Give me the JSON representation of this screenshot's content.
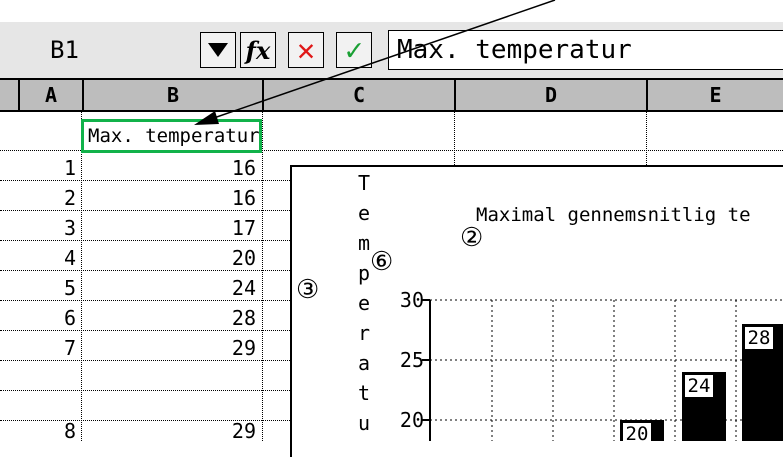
{
  "formula_bar": {
    "cell_ref": "B1",
    "fx_label": "fx",
    "cancel_label": "✕",
    "accept_label": "✓",
    "content": "Max. temperatur"
  },
  "columns": [
    "A",
    "B",
    "C",
    "D",
    "E"
  ],
  "cells": {
    "b1": "Max. temperatur"
  },
  "rows": [
    {
      "num": "1",
      "b": "16"
    },
    {
      "num": "2",
      "b": "16"
    },
    {
      "num": "3",
      "b": "17"
    },
    {
      "num": "4",
      "b": "20"
    },
    {
      "num": "5",
      "b": "24"
    },
    {
      "num": "6",
      "b": "28"
    },
    {
      "num": "7",
      "b": "29"
    },
    {
      "num": "8",
      "b": "29"
    }
  ],
  "annotations": {
    "circle_2": "②",
    "circle_3": "③",
    "circle_6": "⑥"
  },
  "chart_data": {
    "type": "bar",
    "title": "Maximal gennemsnitlig te",
    "ylabel": "Temperatu",
    "ylim": [
      15,
      30
    ],
    "yticks": [
      "30",
      "25",
      "20"
    ],
    "grid": true,
    "visible_bars": [
      {
        "value": 20,
        "label": "20"
      },
      {
        "value": 24,
        "label": "24"
      },
      {
        "value": 28,
        "label": "28"
      }
    ]
  }
}
